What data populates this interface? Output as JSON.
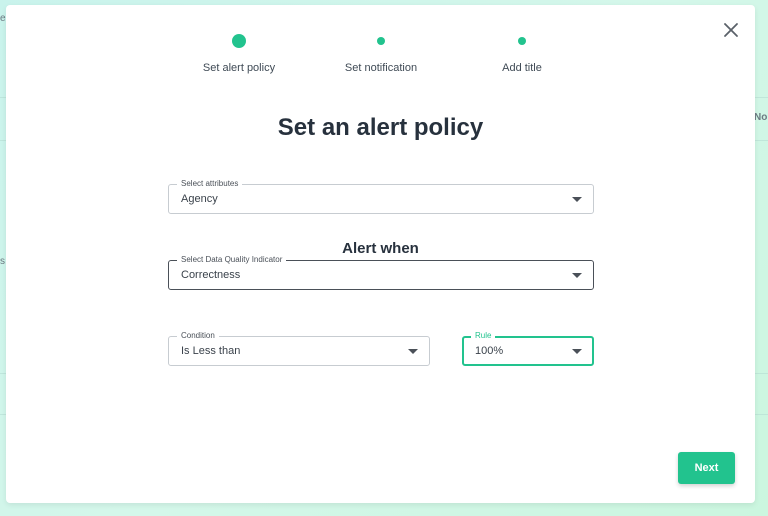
{
  "backdrop": {
    "fragments": [
      "er",
      "No",
      "s"
    ]
  },
  "modal": {
    "close_icon": "close-icon",
    "steps": [
      {
        "label": "Set alert policy",
        "state": "active"
      },
      {
        "label": "Set notification",
        "state": "pending"
      },
      {
        "label": "Add title",
        "state": "pending"
      }
    ],
    "title": "Set an alert policy",
    "alert_heading": "Alert when",
    "fields": {
      "attributes": {
        "label": "Select attributes",
        "value": "Agency"
      },
      "indicator": {
        "label": "Select Data Quality Indicator",
        "value": "Correctness"
      },
      "condition": {
        "label": "Condition",
        "value": "Is Less than"
      },
      "rule": {
        "label": "Rule",
        "value": "100%"
      }
    },
    "next_label": "Next"
  },
  "colors": {
    "accent": "#22c38e",
    "text_dark": "#27313d"
  }
}
